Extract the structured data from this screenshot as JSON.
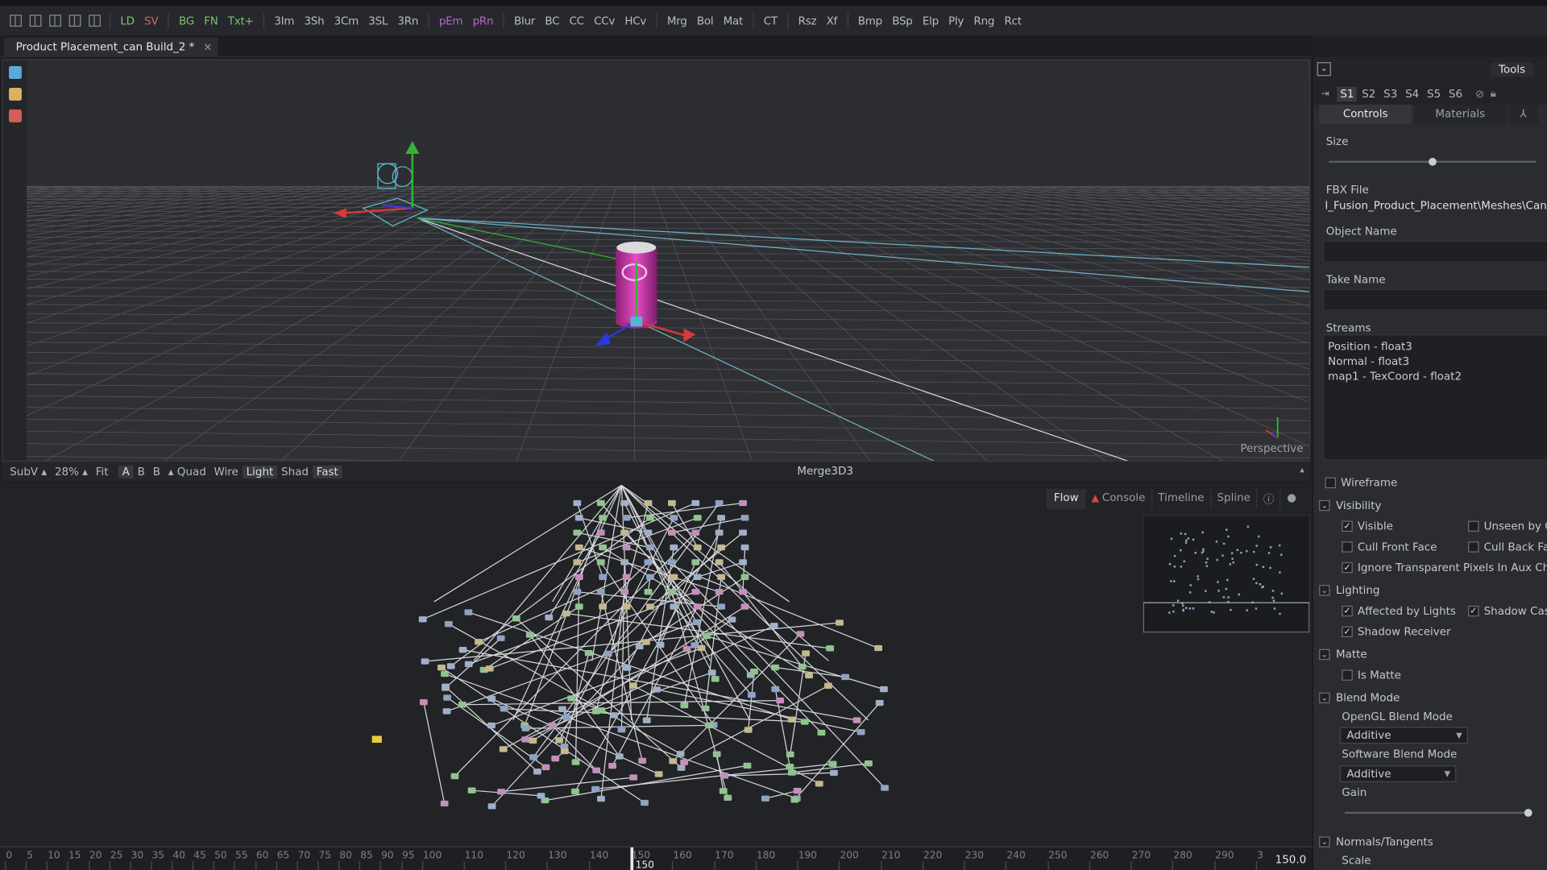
{
  "toolbar": {
    "buttons": [
      {
        "label": "LD",
        "color": "#7cc46a"
      },
      {
        "label": "SV",
        "color": "#d06a5a"
      },
      {
        "label": "BG",
        "color": "#7cc46a"
      },
      {
        "label": "FN",
        "color": "#7cc46a"
      },
      {
        "label": "Txt+",
        "color": "#7cc46a"
      },
      {
        "label": "3Im",
        "color": "#b9bcc3"
      },
      {
        "label": "3Sh",
        "color": "#b9bcc3"
      },
      {
        "label": "3Cm",
        "color": "#b9bcc3"
      },
      {
        "label": "3SL",
        "color": "#b9bcc3"
      },
      {
        "label": "3Rn",
        "color": "#b9bcc3"
      },
      {
        "label": "pEm",
        "color": "#b868c8"
      },
      {
        "label": "pRn",
        "color": "#b868c8"
      },
      {
        "label": "Blur",
        "color": "#b9bcc3"
      },
      {
        "label": "BC",
        "color": "#b9bcc3"
      },
      {
        "label": "CC",
        "color": "#b9bcc3"
      },
      {
        "label": "CCv",
        "color": "#b9bcc3"
      },
      {
        "label": "HCv",
        "color": "#b9bcc3"
      },
      {
        "label": "Mrg",
        "color": "#b9bcc3"
      },
      {
        "label": "Bol",
        "color": "#b9bcc3"
      },
      {
        "label": "Mat",
        "color": "#b9bcc3"
      },
      {
        "label": "CT",
        "color": "#b9bcc3"
      },
      {
        "label": "Rsz",
        "color": "#b9bcc3"
      },
      {
        "label": "Xf",
        "color": "#b9bcc3"
      },
      {
        "label": "Bmp",
        "color": "#b9bcc3"
      },
      {
        "label": "BSp",
        "color": "#b9bcc3"
      },
      {
        "label": "Elp",
        "color": "#b9bcc3"
      },
      {
        "label": "Ply",
        "color": "#b9bcc3"
      },
      {
        "label": "Rng",
        "color": "#b9bcc3"
      },
      {
        "label": "Rct",
        "color": "#b9bcc3"
      }
    ]
  },
  "document_tab": {
    "title": "Product Placement_can Build_2 *",
    "close": "×"
  },
  "viewer": {
    "label": "Perspective"
  },
  "viewer_bar": {
    "items": [
      "SubV ▴",
      "28% ▴",
      "Fit",
      "A",
      "B",
      "B",
      "▴ Quad",
      "Wire",
      "Light",
      "Shad",
      "Fast"
    ],
    "title": "Merge3D3",
    "arrow": "▴"
  },
  "flow": {
    "tabs": [
      "Flow",
      "Console",
      "Timeline",
      "Spline"
    ]
  },
  "timeline": {
    "ticks": [
      "0",
      "5",
      "10",
      "15",
      "20",
      "25",
      "30",
      "35",
      "40",
      "45",
      "50",
      "55",
      "60",
      "65",
      "70",
      "75",
      "80",
      "85",
      "90",
      "95",
      "100",
      "110",
      "120",
      "130",
      "140",
      "150",
      "160",
      "170",
      "180",
      "190",
      "200",
      "210",
      "220",
      "230",
      "240",
      "250",
      "260",
      "270",
      "280",
      "290",
      "3"
    ],
    "playhead_label": "150",
    "value": "150.0",
    "playhead_frame": 150
  },
  "panel": {
    "tools_tab": "Tools",
    "slots": [
      "S1",
      "S2",
      "S3",
      "S4",
      "S5",
      "S6"
    ],
    "control_tabs": [
      "Controls",
      "Materials"
    ],
    "size_label": "Size",
    "size_value": 0.5,
    "fbx_label": "FBX File",
    "fbx_value": "l_Fusion_Product_Placement\\Meshes\\Can.fbx",
    "object_name_label": "Object Name",
    "take_name_label": "Take Name",
    "streams_label": "Streams",
    "streams": [
      "Position - float3",
      "Normal - float3",
      "map1 - TexCoord - float2"
    ],
    "wireframe": "Wireframe",
    "visibility": "Visibility",
    "visible": "Visible",
    "unseen": "Unseen by Ca",
    "cull_front": "Cull Front Face",
    "cull_back": "Cull Back Face",
    "ignore_transparent": "Ignore Transparent Pixels In Aux Channel",
    "lighting": "Lighting",
    "affected_by_lights": "Affected by Lights",
    "shadow_caster": "Shadow Caste",
    "shadow_receiver": "Shadow Receiver",
    "matte": "Matte",
    "is_matte": "Is Matte",
    "blend_mode": "Blend Mode",
    "opengl_blend_label": "OpenGL Blend Mode",
    "opengl_blend_value": "Additive",
    "software_blend_label": "Software Blend Mode",
    "software_blend_value": "Additive",
    "gain_label": "Gain",
    "gain_value": 1.0,
    "normals": "Normals/Tangents",
    "scale": "Scale"
  }
}
